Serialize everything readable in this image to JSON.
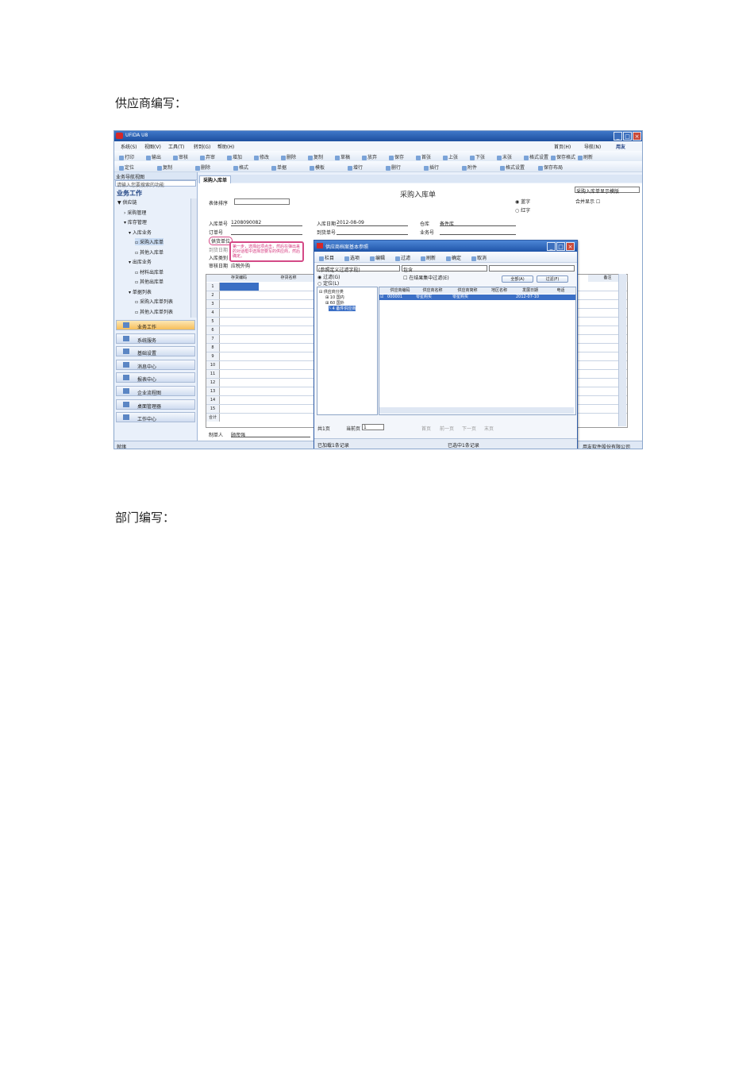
{
  "doc": {
    "heading1": "供应商编写：",
    "heading2": "部门编写："
  },
  "app": {
    "title": "UFIDA U8",
    "menus": [
      "系统(S)",
      "视图(V)",
      "工具(T)",
      "转到(G)",
      "帮助(H)"
    ],
    "top_right": {
      "home": "首页(H)",
      "nav": "导航(N)",
      "brand": "用友"
    },
    "toolbar1": [
      "打印",
      "输出",
      "审核",
      "弃审",
      "增加",
      "修改",
      "删除",
      "复制",
      "草稿",
      "放弃",
      "保存",
      "首张",
      "上张",
      "下张",
      "末张",
      "格式设置",
      "保存格式",
      "刷新"
    ],
    "toolbar2": [
      "定位",
      "复制",
      "删除",
      "格式",
      "单据",
      "模板",
      "增行",
      "删行",
      "插行",
      "附件",
      "格式设置",
      "保存布局"
    ],
    "nav": {
      "header": "业务导航视图",
      "search_placeholder": "请输入您要搜索的功能",
      "section": "业务工作",
      "tree": [
        "供应链",
        "采购管理",
        "库存管理",
        "入库业务",
        "采购入库单",
        "其他入库单",
        "出库业务",
        "材料出库单",
        "其他出库单",
        "单据列表",
        "采购入库单列表",
        "其他入库单列表"
      ],
      "buttons": [
        "业务工作",
        "系统服务",
        "基础设置",
        "消息中心",
        "报表中心",
        "企业流程图",
        "桌面管理器",
        "工作中心"
      ]
    },
    "tab": "采购入库单",
    "form": {
      "title": "采购入库单",
      "sort_label": "表体排序",
      "display_template": "采购入库单显示模版",
      "blue_label": "蓝字",
      "red_label": "红字",
      "merge_label": "合并显示",
      "labels": {
        "doc_no": "入库单号",
        "order_no": "订单号",
        "supplier": "供货单位",
        "arrival_date": "到货日期",
        "in_type": "入库类别",
        "audit_date": "审核日期",
        "in_date": "入库日期",
        "arrival_no": "到货单号",
        "warehouse": "仓库",
        "business_no": "业务号",
        "maker": "制单人"
      },
      "values": {
        "doc_no": "1208090082",
        "in_date": "2012-08-09",
        "warehouse": "备件库",
        "in_type": "应税外购",
        "maker": "顾彦强"
      },
      "callout": "第一步，选择此项点击，然后在弹出来的对话框中选择您要写的供应商，然后确定。",
      "grid_headers": [
        "存货编码",
        "存货名称",
        "备注"
      ],
      "row_total": "合计"
    },
    "dialog": {
      "title": "供应商档案基本参照",
      "toolbar": [
        "栏目",
        "选项",
        "编辑",
        "过滤",
        "刷新",
        "确定",
        "取消"
      ],
      "filter_field": "(参照定义过滤字段)",
      "filter_op": "包含",
      "chk_label": "在结果集中过滤(E)",
      "radio_filter": "过滤(G)",
      "radio_locate": "定位(L)",
      "btn_all": "全部(A)",
      "btn_filter": "过滤(F)",
      "tree": [
        "供应商分类",
        "10 国内",
        "60 国外",
        "4 备件供应商"
      ],
      "headers": [
        "供应商编码",
        "供应商名称",
        "供应商简称",
        "地区名称",
        "发展日期",
        "电话"
      ],
      "row": {
        "code": "000001",
        "name": "零星购买",
        "short": "零星购买",
        "date": "2012-07-10"
      },
      "paging": {
        "total": "共1页",
        "current_label": "当前页",
        "current": "1",
        "first": "首页",
        "prev": "前一页",
        "next": "下一页",
        "last": "末页"
      },
      "status_left": "已加载1条记录",
      "status_right": "已选中1条记录"
    },
    "status": "就绪",
    "status_right": "用友软件股份有限公司"
  }
}
